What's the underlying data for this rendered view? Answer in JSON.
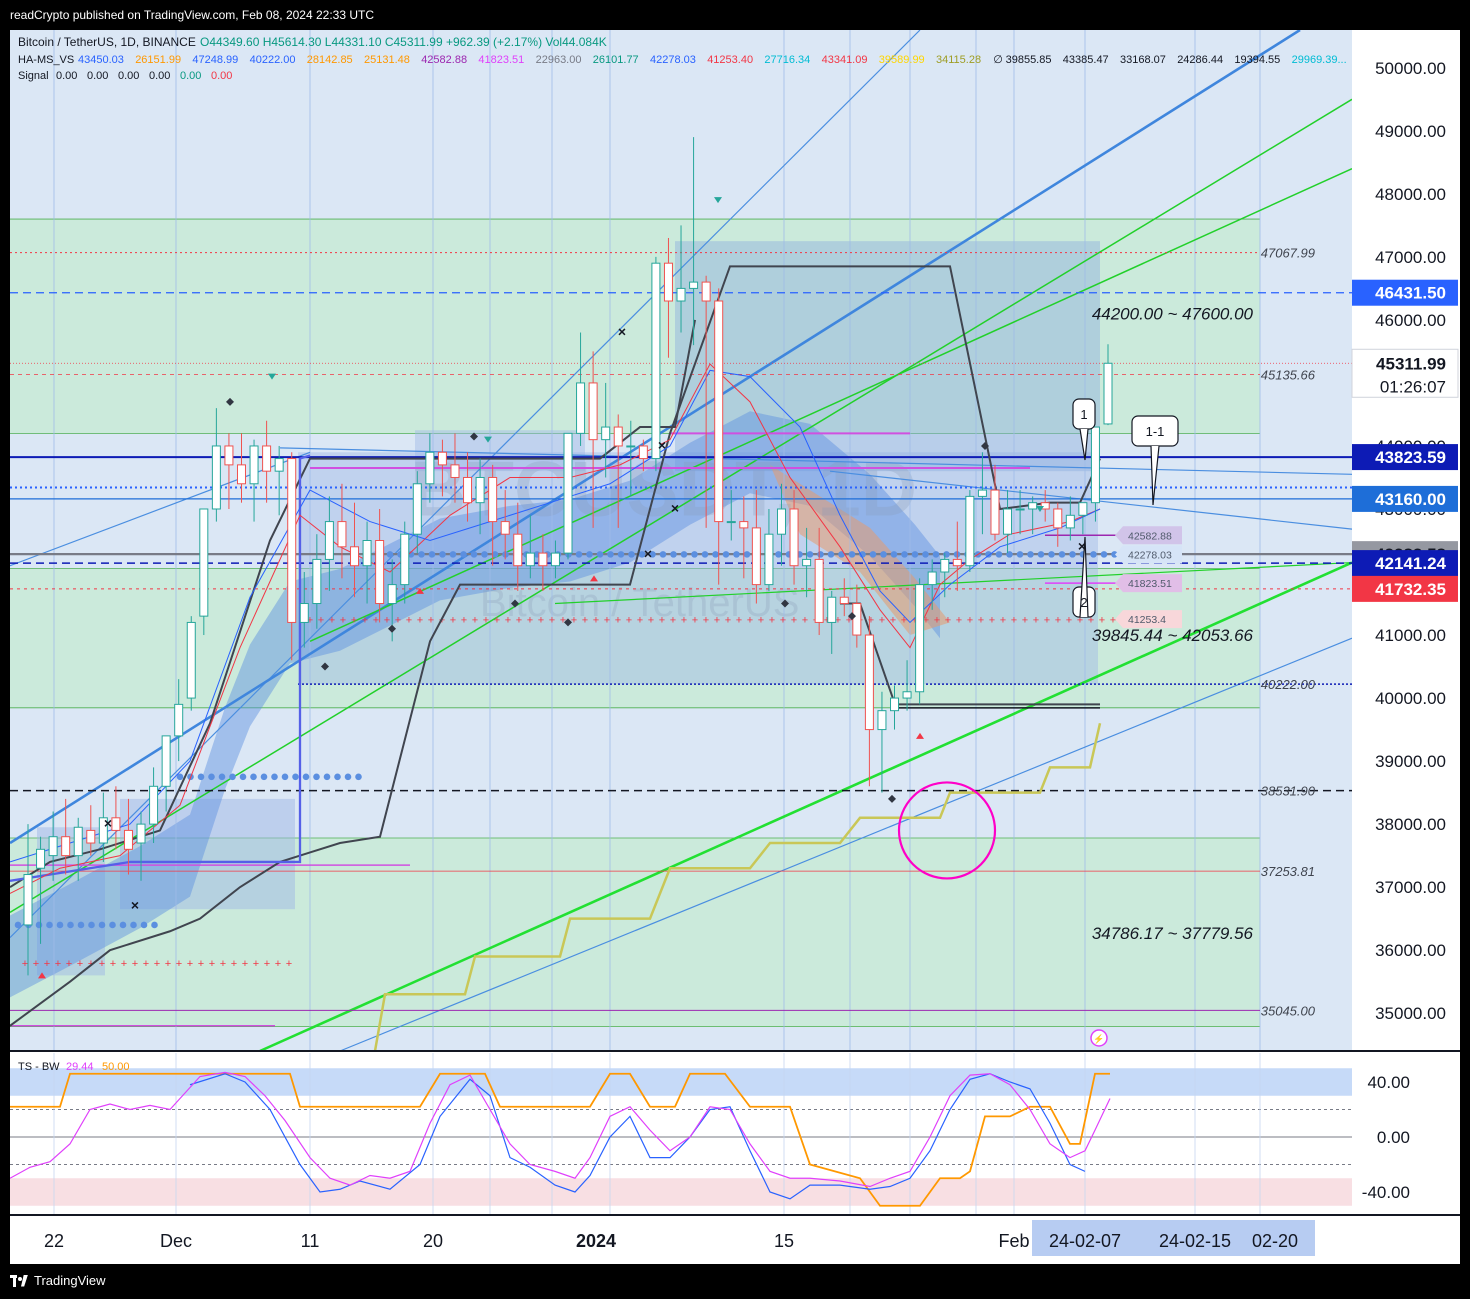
{
  "header": {
    "published_line": "readCrypto published on TradingView.com, Feb 08, 2024 22:33 UTC"
  },
  "legend": {
    "symbol": "Bitcoin / TetherUS, 1D, BINANCE",
    "ohlc": "O44349.60  H45614.30  L44331.10  C45311.99  +962.39 (+2.17%)  Vol44.084K",
    "hams_label": "HA-MS_VS",
    "hams_values": [
      {
        "v": "43450.03",
        "c": "#2962ff"
      },
      {
        "v": "26151.99",
        "c": "#ff9800"
      },
      {
        "v": "47248.99",
        "c": "#2962ff"
      },
      {
        "v": "40222.00",
        "c": "#2962ff"
      },
      {
        "v": "28142.85",
        "c": "#ff9800"
      },
      {
        "v": "25131.48",
        "c": "#ff9800"
      },
      {
        "v": "42582.88",
        "c": "#9c27b0"
      },
      {
        "v": "41823.51",
        "c": "#e040fb"
      },
      {
        "v": "22963.00",
        "c": "#787b86"
      },
      {
        "v": "26101.77",
        "c": "#089981"
      },
      {
        "v": "42278.03",
        "c": "#2962ff"
      },
      {
        "v": "41253.40",
        "c": "#f23645"
      },
      {
        "v": "27716.34",
        "c": "#00bcd4"
      },
      {
        "v": "43341.09",
        "c": "#f23645"
      },
      {
        "v": "39589.99",
        "c": "#ffd600"
      },
      {
        "v": "34115.28",
        "c": "#9e9d24"
      },
      {
        "v": "∅",
        "c": "#131722"
      },
      {
        "v": "39855.85",
        "c": "#131722"
      },
      {
        "v": "43385.47",
        "c": "#131722"
      },
      {
        "v": "33168.07",
        "c": "#131722"
      },
      {
        "v": "24286.44",
        "c": "#131722"
      },
      {
        "v": "19394.55",
        "c": "#131722"
      },
      {
        "v": "29969.39...",
        "c": "#00bcd4"
      }
    ],
    "signal_label": "Signal",
    "signal_values": [
      {
        "v": "0.00",
        "c": "#131722"
      },
      {
        "v": "0.00",
        "c": "#131722"
      },
      {
        "v": "0.00",
        "c": "#131722"
      },
      {
        "v": "0.00",
        "c": "#131722"
      },
      {
        "v": "0.00",
        "c": "#089981"
      },
      {
        "v": "0.00",
        "c": "#f23645"
      }
    ],
    "ts_label": "TS - BW",
    "ts_v1": "29.44",
    "ts_v2": "50.00"
  },
  "watermark": {
    "big": "BTCUSDT, 1D",
    "small": "Bitcoin / TetherUS"
  },
  "price_axis": {
    "ticks": [
      "50000.00",
      "49000.00",
      "48000.00",
      "47000.00",
      "46000.00",
      "45000.00",
      "44000.00",
      "43000.00",
      "42000.00",
      "41000.00",
      "40000.00",
      "39000.00",
      "38000.00",
      "37000.00",
      "36000.00",
      "35000.00"
    ],
    "tick_values": [
      50000,
      49000,
      48000,
      47000,
      46000,
      45000,
      44000,
      43000,
      42000,
      41000,
      40000,
      39000,
      38000,
      37000,
      36000,
      35000
    ],
    "tags": [
      {
        "label": "46431.50",
        "value": 46431.5,
        "bg": "#2962ff",
        "fg": "#ffffff"
      },
      {
        "label": "45311.99",
        "value": 45311.99,
        "bg": "#ffffff",
        "fg": "#131722",
        "sub": "01:26:07"
      },
      {
        "label": "43823.59",
        "value": 43823.59,
        "bg": "#0d1bb5",
        "fg": "#ffffff"
      },
      {
        "label": "43160.00",
        "value": 43160,
        "bg": "#1e6ed8",
        "fg": "#ffffff"
      },
      {
        "label": "42283.58",
        "value": 42283.58,
        "bg": "#9598a1",
        "fg": "#131722"
      },
      {
        "label": "42141.24",
        "value": 42141.24,
        "bg": "#0d1bb5",
        "fg": "#ffffff"
      },
      {
        "label": "41732.35",
        "value": 41732.35,
        "bg": "#f23645",
        "fg": "#ffffff"
      }
    ]
  },
  "level_labels": [
    {
      "label": "47067.99",
      "value": 47067.99
    },
    {
      "label": "45135.66",
      "value": 45135.66
    },
    {
      "label": "40222.00",
      "value": 40222
    },
    {
      "label": "38531.90",
      "value": 38531.9
    },
    {
      "label": "37253.81",
      "value": 37253.81
    },
    {
      "label": "35045.00",
      "value": 35045
    }
  ],
  "zone_labels": [
    {
      "label": "44200.00 ~ 47600.00",
      "value": 46100
    },
    {
      "label": "39845.44 ~ 42053.66",
      "value": 41000
    },
    {
      "label": "34786.17 ~ 37779.56",
      "value": 36270
    }
  ],
  "pill_labels": [
    {
      "label": "42582.88",
      "value": 42582.88,
      "bg": "#d1c4e9"
    },
    {
      "label": "42278.03",
      "value": 42278.03,
      "bg": "#d6e4f7"
    },
    {
      "label": "41823.51",
      "value": 41823.51,
      "bg": "#e1bee7"
    },
    {
      "label": "41253.4",
      "value": 41253.4,
      "bg": "#f8d7da"
    }
  ],
  "callouts": {
    "c1": "1",
    "c2": "2",
    "c11": "1-1"
  },
  "time_axis": {
    "labels": [
      {
        "label": "22",
        "x": 44
      },
      {
        "label": "Dec",
        "x": 166
      },
      {
        "label": "11",
        "x": 300
      },
      {
        "label": "20",
        "x": 423
      },
      {
        "label": "2024",
        "x": 586
      },
      {
        "label": "15",
        "x": 774
      },
      {
        "label": "Feb",
        "x": 1004
      }
    ],
    "range_labels": [
      "24-02-07",
      "24-02-15",
      "02-20"
    ]
  },
  "oscillator": {
    "ticks": [
      "40.00",
      "0.00",
      "-40.00"
    ],
    "tick_values": [
      40,
      0,
      -40
    ]
  },
  "footer": {
    "brand": "TradingView"
  },
  "chart_data": {
    "type": "candlestick",
    "title": "Bitcoin / TetherUS, 1D, BINANCE",
    "ylim": [
      34400,
      50600
    ],
    "candles": [
      {
        "o": 36400,
        "h": 38000,
        "l": 35600,
        "c": 37200
      },
      {
        "o": 37300,
        "h": 37800,
        "l": 36100,
        "c": 37600
      },
      {
        "o": 37500,
        "h": 38200,
        "l": 37100,
        "c": 37800
      },
      {
        "o": 37800,
        "h": 38400,
        "l": 37200,
        "c": 37500
      },
      {
        "o": 37500,
        "h": 38100,
        "l": 37100,
        "c": 37950
      },
      {
        "o": 37900,
        "h": 38300,
        "l": 37500,
        "c": 37700
      },
      {
        "o": 37700,
        "h": 38500,
        "l": 37400,
        "c": 38100
      },
      {
        "o": 38100,
        "h": 38600,
        "l": 37600,
        "c": 37900
      },
      {
        "o": 37900,
        "h": 38400,
        "l": 37200,
        "c": 37600
      },
      {
        "o": 37700,
        "h": 38200,
        "l": 37100,
        "c": 38000
      },
      {
        "o": 38000,
        "h": 38900,
        "l": 37700,
        "c": 38600
      },
      {
        "o": 38600,
        "h": 39200,
        "l": 38200,
        "c": 39400
      },
      {
        "o": 39400,
        "h": 40300,
        "l": 39000,
        "c": 39900
      },
      {
        "o": 40000,
        "h": 41300,
        "l": 39800,
        "c": 41200
      },
      {
        "o": 41300,
        "h": 43000,
        "l": 41000,
        "c": 43000
      },
      {
        "o": 43000,
        "h": 44600,
        "l": 42800,
        "c": 44000
      },
      {
        "o": 44000,
        "h": 44200,
        "l": 43000,
        "c": 43700
      },
      {
        "o": 43700,
        "h": 44200,
        "l": 43100,
        "c": 43400
      },
      {
        "o": 43400,
        "h": 44100,
        "l": 42800,
        "c": 44000
      },
      {
        "o": 44000,
        "h": 44400,
        "l": 43100,
        "c": 43600
      },
      {
        "o": 43600,
        "h": 44000,
        "l": 42900,
        "c": 43800
      },
      {
        "o": 43800,
        "h": 43900,
        "l": 40600,
        "c": 41200
      },
      {
        "o": 41200,
        "h": 42000,
        "l": 40800,
        "c": 41500
      },
      {
        "o": 41500,
        "h": 42600,
        "l": 41100,
        "c": 42200
      },
      {
        "o": 42200,
        "h": 43200,
        "l": 41700,
        "c": 42800
      },
      {
        "o": 42800,
        "h": 43400,
        "l": 41900,
        "c": 42400
      },
      {
        "o": 42400,
        "h": 43100,
        "l": 41600,
        "c": 42100
      },
      {
        "o": 42100,
        "h": 42800,
        "l": 41500,
        "c": 42500
      },
      {
        "o": 42500,
        "h": 43000,
        "l": 41200,
        "c": 41500
      },
      {
        "o": 41500,
        "h": 42200,
        "l": 40900,
        "c": 41800
      },
      {
        "o": 41800,
        "h": 42800,
        "l": 41500,
        "c": 42600
      },
      {
        "o": 42600,
        "h": 43600,
        "l": 42300,
        "c": 43400
      },
      {
        "o": 43400,
        "h": 44200,
        "l": 43100,
        "c": 43900
      },
      {
        "o": 43900,
        "h": 44100,
        "l": 43200,
        "c": 43700
      },
      {
        "o": 43700,
        "h": 44200,
        "l": 43100,
        "c": 43500
      },
      {
        "o": 43500,
        "h": 43900,
        "l": 42800,
        "c": 43100
      },
      {
        "o": 43100,
        "h": 43800,
        "l": 42600,
        "c": 43500
      },
      {
        "o": 43500,
        "h": 43700,
        "l": 42100,
        "c": 42800
      },
      {
        "o": 42800,
        "h": 43300,
        "l": 42200,
        "c": 42600
      },
      {
        "o": 42600,
        "h": 43100,
        "l": 41700,
        "c": 42100
      },
      {
        "o": 42100,
        "h": 42900,
        "l": 41900,
        "c": 42300
      },
      {
        "o": 42300,
        "h": 42600,
        "l": 41700,
        "c": 42100
      },
      {
        "o": 42100,
        "h": 42500,
        "l": 41900,
        "c": 42300
      },
      {
        "o": 42300,
        "h": 44200,
        "l": 42200,
        "c": 44200
      },
      {
        "o": 44200,
        "h": 45800,
        "l": 44000,
        "c": 45000
      },
      {
        "o": 45000,
        "h": 45500,
        "l": 42700,
        "c": 44100
      },
      {
        "o": 44100,
        "h": 45000,
        "l": 43500,
        "c": 44300
      },
      {
        "o": 44300,
        "h": 44500,
        "l": 42700,
        "c": 44000
      },
      {
        "o": 44000,
        "h": 44400,
        "l": 43200,
        "c": 44000
      },
      {
        "o": 44000,
        "h": 44100,
        "l": 43600,
        "c": 43800
      },
      {
        "o": 43800,
        "h": 47000,
        "l": 43600,
        "c": 46900
      },
      {
        "o": 46900,
        "h": 47300,
        "l": 45400,
        "c": 46300
      },
      {
        "o": 46300,
        "h": 47500,
        "l": 45800,
        "c": 46500
      },
      {
        "o": 46500,
        "h": 48900,
        "l": 45600,
        "c": 46600
      },
      {
        "o": 46600,
        "h": 46700,
        "l": 42700,
        "c": 46300
      },
      {
        "o": 46300,
        "h": 46500,
        "l": 41800,
        "c": 42800
      },
      {
        "o": 42800,
        "h": 43300,
        "l": 42500,
        "c": 42800
      },
      {
        "o": 42800,
        "h": 43200,
        "l": 41900,
        "c": 42700
      },
      {
        "o": 42700,
        "h": 43300,
        "l": 41500,
        "c": 41800
      },
      {
        "o": 41800,
        "h": 43000,
        "l": 41700,
        "c": 42600
      },
      {
        "o": 42600,
        "h": 43400,
        "l": 42100,
        "c": 43000
      },
      {
        "o": 43000,
        "h": 43300,
        "l": 41800,
        "c": 42100
      },
      {
        "o": 42100,
        "h": 42700,
        "l": 41600,
        "c": 42200
      },
      {
        "o": 42200,
        "h": 42700,
        "l": 41000,
        "c": 41200
      },
      {
        "o": 41200,
        "h": 41700,
        "l": 40700,
        "c": 41600
      },
      {
        "o": 41600,
        "h": 41900,
        "l": 41300,
        "c": 41500
      },
      {
        "o": 41500,
        "h": 41800,
        "l": 40800,
        "c": 41000
      },
      {
        "o": 41000,
        "h": 41300,
        "l": 38600,
        "c": 39500
      },
      {
        "o": 39500,
        "h": 40100,
        "l": 38500,
        "c": 39800
      },
      {
        "o": 39800,
        "h": 40200,
        "l": 39500,
        "c": 40000
      },
      {
        "o": 40000,
        "h": 40600,
        "l": 39800,
        "c": 40100
      },
      {
        "o": 40100,
        "h": 41900,
        "l": 39900,
        "c": 41800
      },
      {
        "o": 41800,
        "h": 42200,
        "l": 41400,
        "c": 42000
      },
      {
        "o": 42000,
        "h": 42300,
        "l": 41600,
        "c": 42200
      },
      {
        "o": 42200,
        "h": 42800,
        "l": 41700,
        "c": 42100
      },
      {
        "o": 42100,
        "h": 43300,
        "l": 42000,
        "c": 43200
      },
      {
        "o": 43200,
        "h": 43900,
        "l": 42600,
        "c": 43300
      },
      {
        "o": 43300,
        "h": 43700,
        "l": 42500,
        "c": 42600
      },
      {
        "o": 42600,
        "h": 43300,
        "l": 42300,
        "c": 43000
      },
      {
        "o": 43000,
        "h": 43300,
        "l": 42600,
        "c": 43000
      },
      {
        "o": 43000,
        "h": 43200,
        "l": 42600,
        "c": 43100
      },
      {
        "o": 43100,
        "h": 43300,
        "l": 42800,
        "c": 43000
      },
      {
        "o": 43000,
        "h": 43100,
        "l": 42400,
        "c": 42700
      },
      {
        "o": 42700,
        "h": 43200,
        "l": 42500,
        "c": 42900
      },
      {
        "o": 42900,
        "h": 43000,
        "l": 42600,
        "c": 43100
      },
      {
        "o": 43100,
        "h": 44100,
        "l": 42800,
        "c": 44300
      },
      {
        "o": 44349.6,
        "h": 45614.3,
        "l": 44331.1,
        "c": 45311.99
      }
    ]
  }
}
